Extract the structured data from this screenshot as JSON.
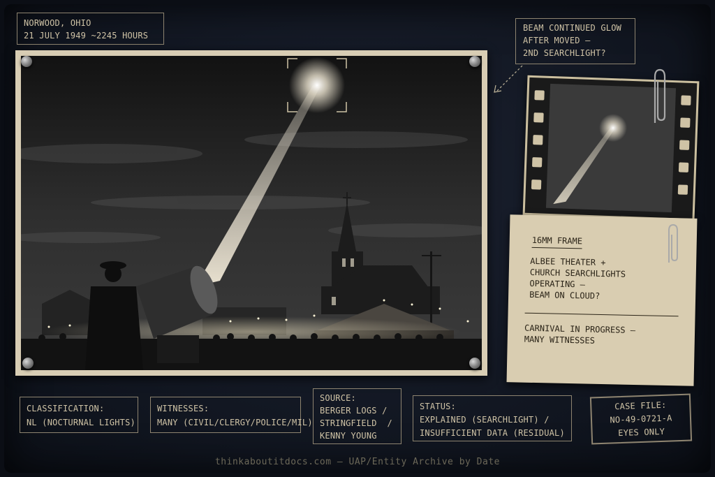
{
  "header": {
    "location": "NORWOOD, OHIO",
    "datetime": "21 JULY 1949 ~2245 HOURS"
  },
  "callout": {
    "line1": "BEAM CONTINUED GLOW",
    "line2": "AFTER MOVED –",
    "line3": "2ND SEARCHLIGHT?"
  },
  "note": {
    "title": "16MM FRAME",
    "line1": "ALBEE THEATER +",
    "line2": "CHURCH SEARCHLIGHTS",
    "line3": "OPERATING –",
    "line4": "BEAM ON CLOUD?",
    "line5": "CARNIVAL IN PROGRESS –",
    "line6": "MANY WITNESSES"
  },
  "classification": {
    "label": "CLASSIFICATION:",
    "value": "NL (NOCTURNAL LIGHTS)"
  },
  "witnesses": {
    "label": "WITNESSES:",
    "value": "MANY (CIVIL/CLERGY/POLICE/MIL)"
  },
  "source": {
    "label": "SOURCE:",
    "line1": "BERGER LOGS /",
    "line2": "STRINGFIELD  /",
    "line3": "KENNY YOUNG"
  },
  "status": {
    "label": "STATUS:",
    "line1": "EXPLAINED (SEARCHLIGHT) /",
    "line2": "INSUFFICIENT DATA (RESIDUAL)"
  },
  "case_file": {
    "line1": "CASE FILE:",
    "line2": "NO-49-0721-A",
    "line3": "EYES ONLY"
  },
  "footer": {
    "text": "thinkaboutitdocs.com — UAP/Entity Archive by Date"
  }
}
